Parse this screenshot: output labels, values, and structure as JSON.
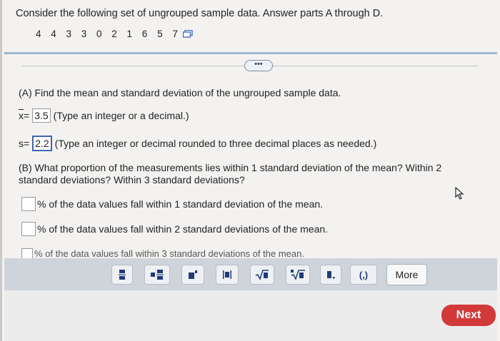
{
  "question": {
    "prompt": "Consider the following set of ungrouped sample data. Answer parts A through D.",
    "dataset": "4 4 3 3 0 2 1 6 5 7"
  },
  "part_a": {
    "heading": "(A) Find the mean and standard deviation of the ungrouped sample data.",
    "mean_symbol": "x",
    "mean_eq": "=",
    "mean_value": "3.5",
    "mean_hint": "(Type an integer or a decimal.)",
    "sd_symbol": "s",
    "sd_eq": "=",
    "sd_value": "2.2",
    "sd_hint": "(Type an integer or decimal rounded to three decimal places as needed.)"
  },
  "part_b": {
    "heading": "(B) What proportion of the measurements lies within 1 standard deviation of the mean? Within 2 standard deviations? Within 3 standard deviations?",
    "row1": "% of the data values fall within 1 standard deviation of the mean.",
    "row2": "% of the data values fall within 2 standard deviations of the mean.",
    "row3": "% of the data values fall within 3 standard deviations of the mean."
  },
  "toolbar": {
    "tools": [
      "fraction-icon",
      "mixed-number-icon",
      "exponent-icon",
      "absolute-value-icon",
      "sqrt-icon",
      "nth-root-icon",
      "decimal-icon",
      "interval-icon"
    ],
    "interval_label": "(,)",
    "more_label": "More"
  },
  "footer": {
    "next_label": "Next"
  },
  "colors": {
    "next": "#d23a3a",
    "selected_border": "#3c66b3",
    "toolbar": "#cfd4db"
  }
}
